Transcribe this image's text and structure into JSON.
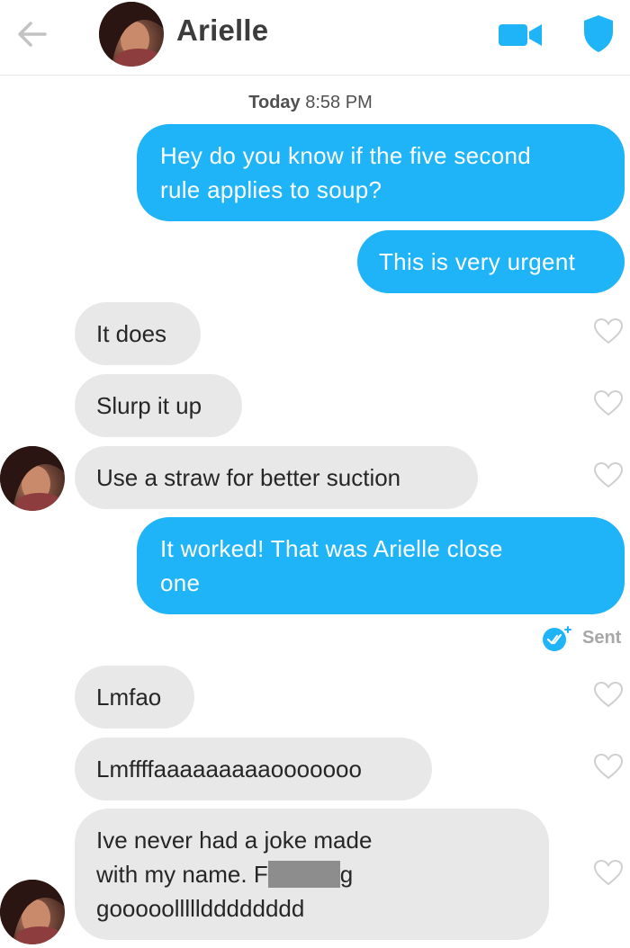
{
  "header": {
    "title": "Arielle",
    "icons": {
      "back": "back-arrow-icon",
      "video": "video-call-icon",
      "safety": "shield-icon"
    },
    "accent": "#1fb4f8"
  },
  "timestamp": {
    "day": "Today",
    "time": "8:58 PM"
  },
  "messages": [
    {
      "from": "me",
      "lines": [
        "Hey do you know if the five second",
        "rule applies to soup?"
      ]
    },
    {
      "from": "me",
      "lines": [
        "This is very urgent"
      ]
    },
    {
      "from": "them",
      "lines": [
        "It does"
      ]
    },
    {
      "from": "them",
      "lines": [
        "Slurp it up"
      ]
    },
    {
      "from": "them",
      "lines": [
        "Use a straw for better suction"
      ]
    },
    {
      "from": "me",
      "lines": [
        "It worked! That was Arielle close",
        "one"
      ]
    },
    {
      "from": "them",
      "lines": [
        "Lmfao"
      ]
    },
    {
      "from": "them",
      "lines": [
        "Lmffffaaaaaaaaaooooooo"
      ]
    },
    {
      "from": "them",
      "lines": [
        "Ive never had a joke made",
        "with my name. F",
        "g",
        "gooooollllldddddddd"
      ]
    }
  ],
  "status": {
    "sent": "Sent"
  },
  "colors": {
    "outgoing": "#1fb4f8",
    "incoming": "#e8e8e8",
    "heart": "#cfcfcf"
  }
}
